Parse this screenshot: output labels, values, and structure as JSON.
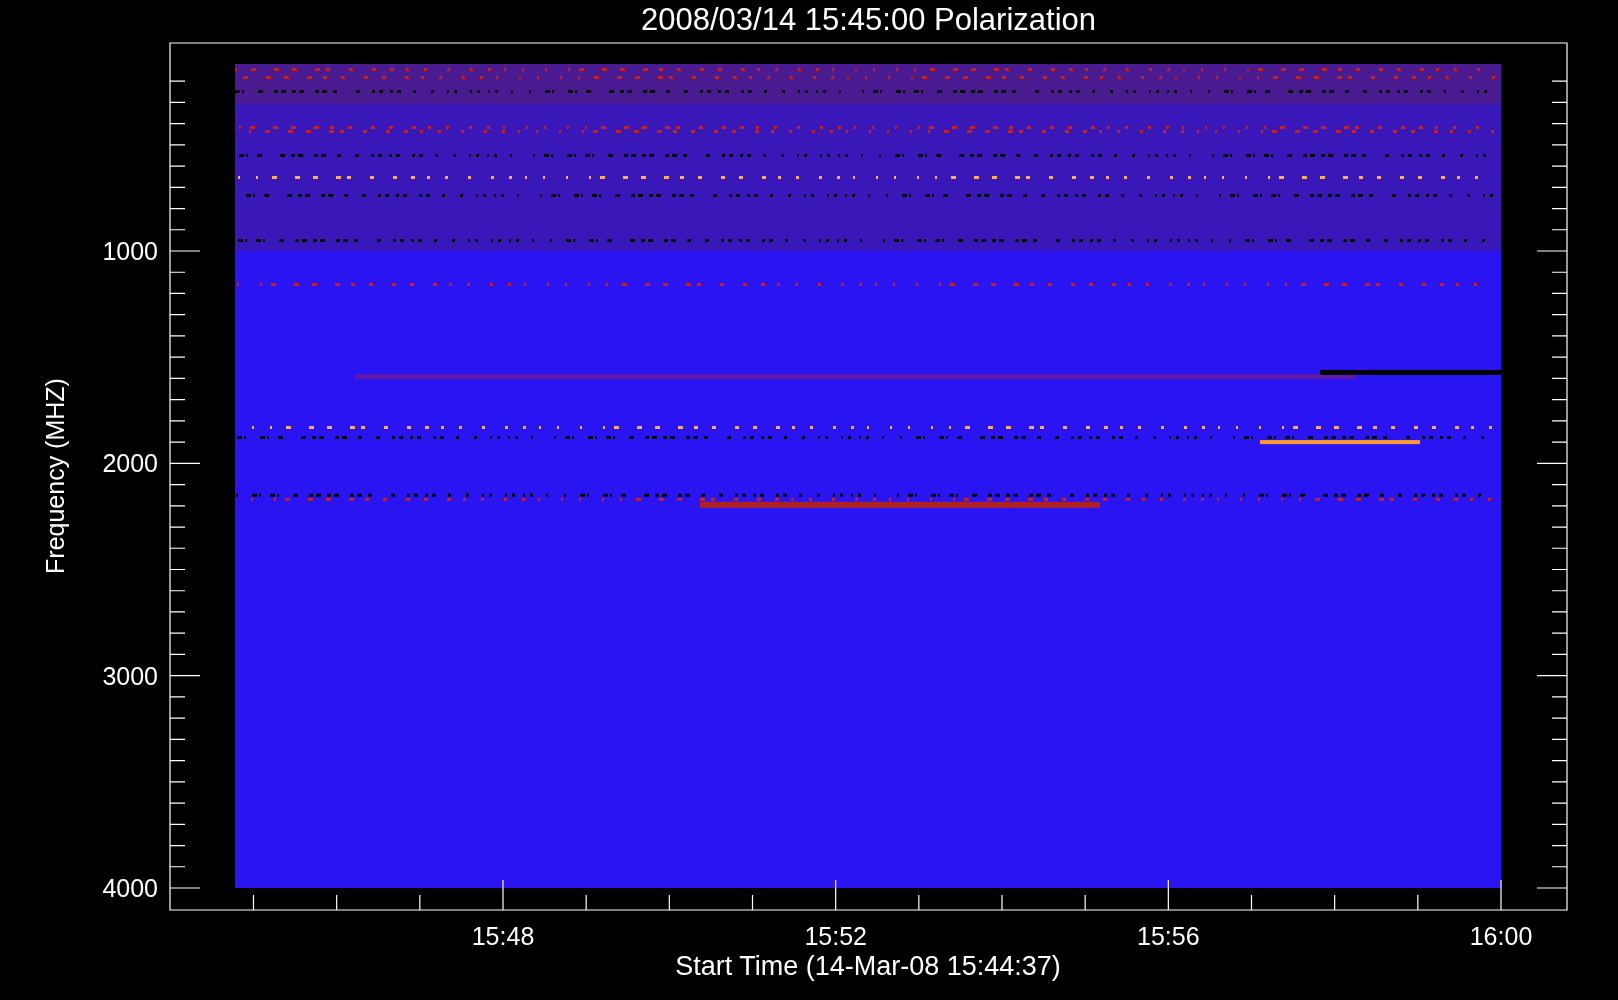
{
  "title": "2008/03/14 15:45:00 Polarization",
  "y_axis": {
    "label": "Frequency (MHZ)",
    "ticks": [
      "1000",
      "2000",
      "3000",
      "4000"
    ]
  },
  "x_axis": {
    "label": "Start Time (14-Mar-08 15:44:37)",
    "ticks": [
      "15:48",
      "15:52",
      "15:56",
      "16:00"
    ]
  }
}
